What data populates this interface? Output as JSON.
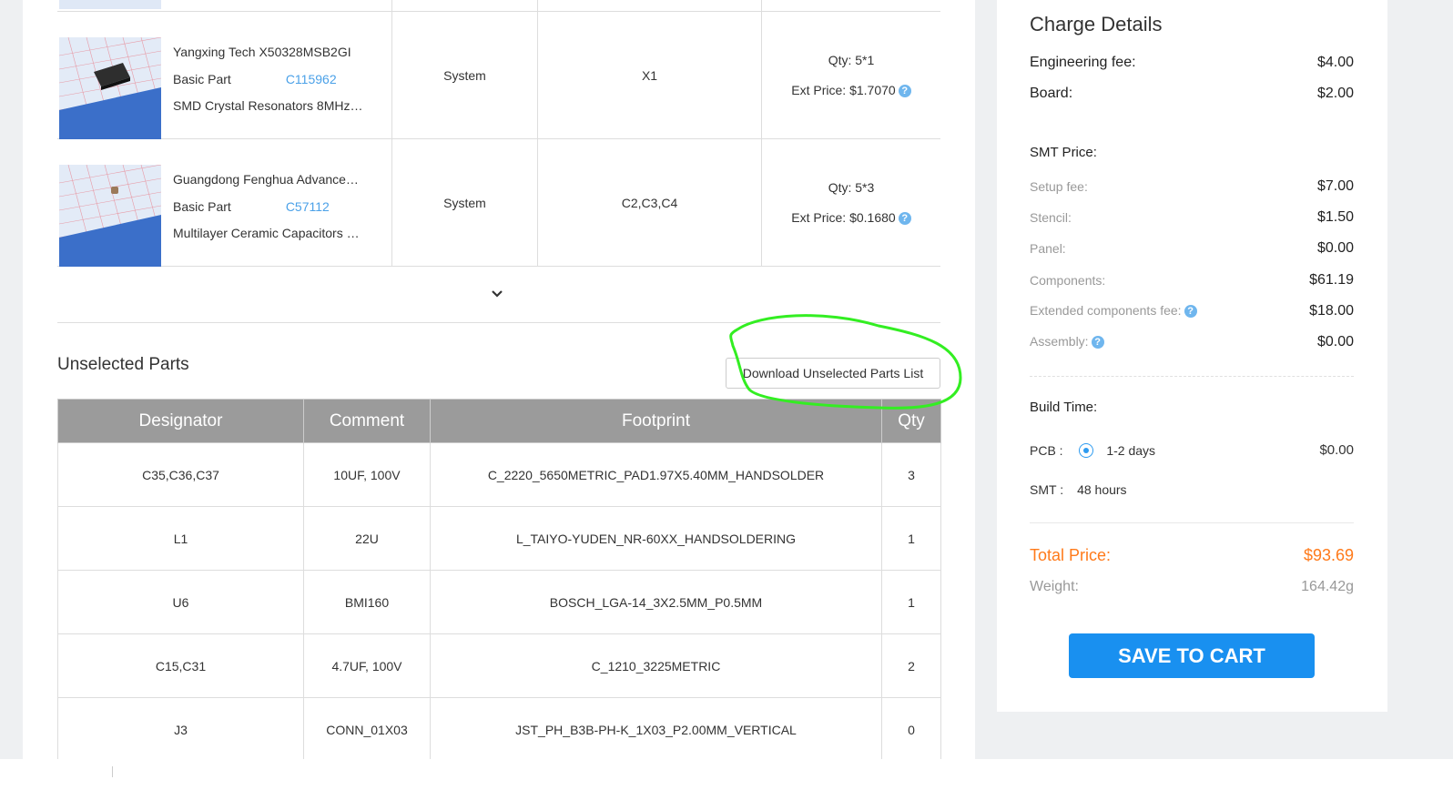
{
  "parts": [
    {
      "manufacturer_part": "Yangxing Tech X50328MSB2GI",
      "type": "Basic Part",
      "lcsc": "C115962",
      "description": "SMD Crystal Resonators 8MHz…",
      "source": "System",
      "designator": "X1",
      "qty": "Qty: 5*1",
      "ext_price": "Ext Price: $1.7070"
    },
    {
      "manufacturer_part": "Guangdong Fenghua Advance…",
      "type": "Basic Part",
      "lcsc": "C57112",
      "description": "Multilayer Ceramic Capacitors …",
      "source": "System",
      "designator": "C2,C3,C4",
      "qty": "Qty: 5*3",
      "ext_price": "Ext Price: $0.1680"
    }
  ],
  "unselected": {
    "title": "Unselected Parts",
    "download_label": "Download Unselected Parts List",
    "headers": [
      "Designator",
      "Comment",
      "Footprint",
      "Qty"
    ],
    "rows": [
      [
        "C35,C36,C37",
        "10UF, 100V",
        "C_2220_5650METRIC_PAD1.97X5.40MM_HANDSOLDER",
        "3"
      ],
      [
        "L1",
        "22U",
        "L_TAIYO-YUDEN_NR-60XX_HANDSOLDERING",
        "1"
      ],
      [
        "U6",
        "BMI160",
        "BOSCH_LGA-14_3X2.5MM_P0.5MM",
        "1"
      ],
      [
        "C15,C31",
        "4.7UF, 100V",
        "C_1210_3225METRIC",
        "2"
      ],
      [
        "J3",
        "CONN_01X03",
        "JST_PH_B3B-PH-K_1X03_P2.00MM_VERTICAL",
        "0"
      ]
    ]
  },
  "charge": {
    "title": "Charge Details",
    "engineering_fee": {
      "label": "Engineering fee:",
      "value": "$4.00"
    },
    "board": {
      "label": "Board:",
      "value": "$2.00"
    },
    "smt_heading": "SMT Price:",
    "smt_items": [
      {
        "label": "Setup fee:",
        "value": "$7.00"
      },
      {
        "label": "Stencil:",
        "value": "$1.50"
      },
      {
        "label": "Panel:",
        "value": "$0.00"
      },
      {
        "label": "Components:",
        "value": "$61.19"
      },
      {
        "label": "Extended components fee:",
        "value": "$18.00"
      },
      {
        "label": "Assembly:",
        "value": "$0.00"
      }
    ],
    "build_time_heading": "Build Time:",
    "pcb": {
      "label": "PCB :",
      "option": "1-2 days",
      "value": "$0.00"
    },
    "smt": {
      "label": "SMT :",
      "value": "48 hours"
    },
    "total": {
      "label": "Total Price:",
      "value": "$93.69"
    },
    "weight": {
      "label": "Weight:",
      "value": "164.42g"
    },
    "save_label": "SAVE TO CART"
  },
  "colors": {
    "accent_blue": "#1990f0",
    "link_blue": "#4ba1e8",
    "total_orange": "#ff7a1a",
    "highlight_green": "#33ee22",
    "header_gray": "#9b9b9b"
  }
}
